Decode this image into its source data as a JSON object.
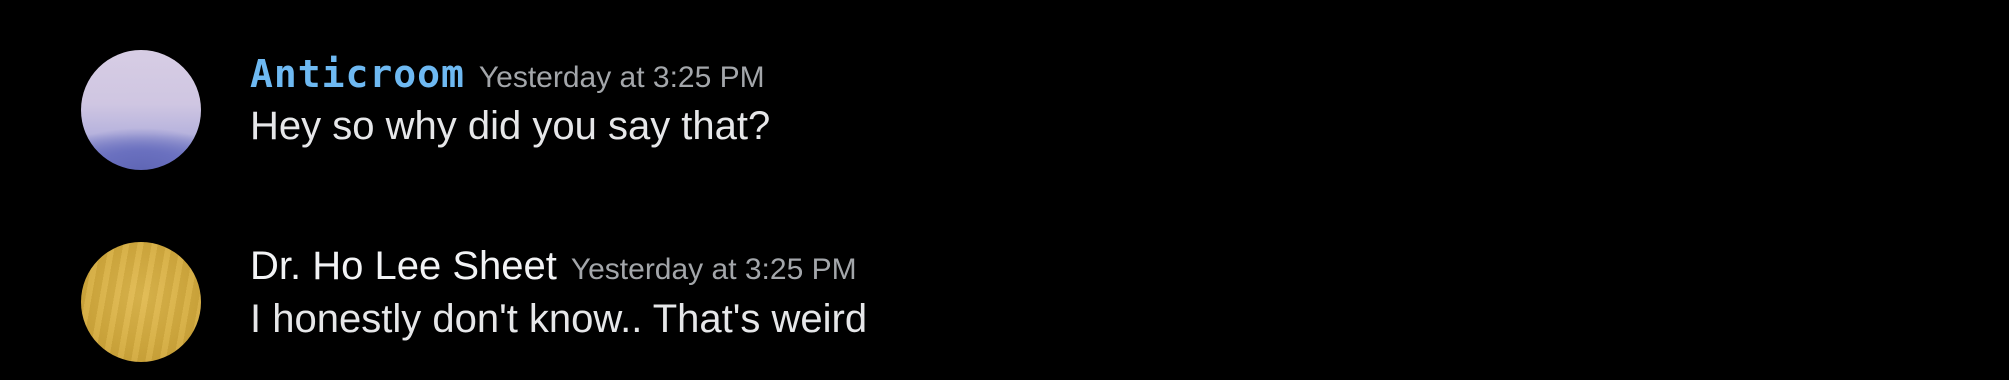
{
  "messages": [
    {
      "username": "Anticroom",
      "timestamp": "Yesterday at 3:25 PM",
      "text": "Hey so why did you say that?",
      "username_color": "#6eb9f2"
    },
    {
      "username": "Dr. Ho Lee Sheet",
      "timestamp": "Yesterday at 3:25 PM",
      "text": "I honestly don't know.. That's weird",
      "username_color": "#f2f3f5"
    }
  ],
  "colors": {
    "background": "#000000",
    "timestamp": "#a3a6aa",
    "message_text": "#e6e7e9"
  }
}
